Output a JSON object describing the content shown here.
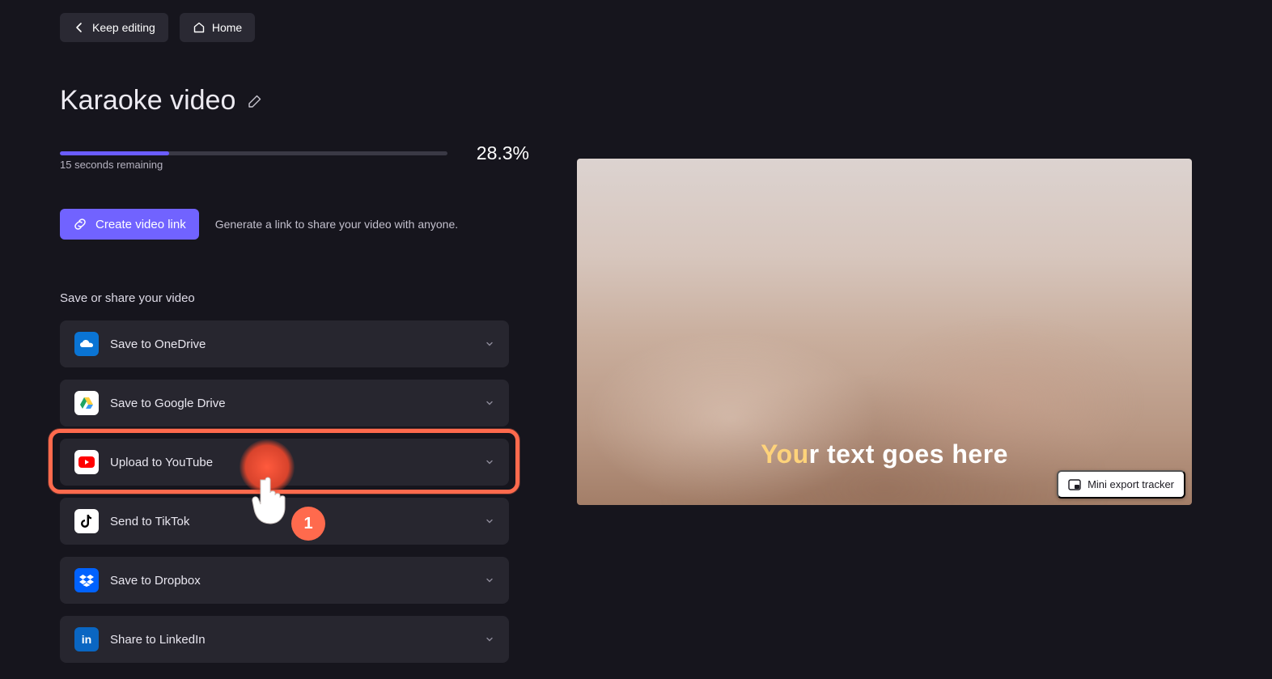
{
  "topbar": {
    "keep_editing": "Keep editing",
    "home": "Home"
  },
  "project": {
    "title": "Karaoke video"
  },
  "export": {
    "percent_text": "28.3%",
    "percent_value": 28.3,
    "remaining": "15 seconds remaining"
  },
  "link": {
    "button": "Create video link",
    "description": "Generate a link to share your video with anyone."
  },
  "share": {
    "section_label": "Save or share your video",
    "items": [
      {
        "label": "Save to OneDrive"
      },
      {
        "label": "Save to Google Drive"
      },
      {
        "label": "Upload to YouTube"
      },
      {
        "label": "Send to TikTok"
      },
      {
        "label": "Save to Dropbox"
      },
      {
        "label": "Share to LinkedIn"
      }
    ]
  },
  "annotation": {
    "step": "1"
  },
  "preview": {
    "overlay_prefix": "You",
    "overlay_rest": "r text goes here",
    "mini_tracker": "Mini export tracker"
  }
}
